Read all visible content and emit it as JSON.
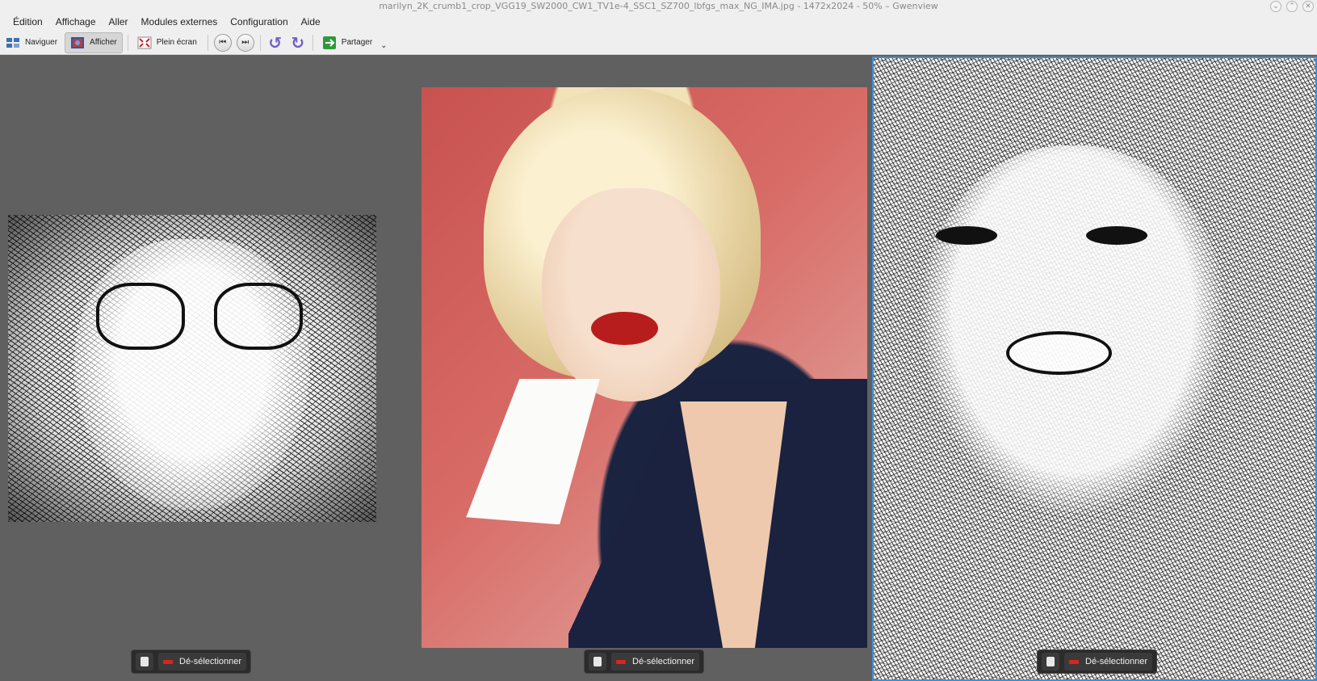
{
  "window": {
    "title": "marilyn_2K_crumb1_crop_VGG19_SW2000_CW1_TV1e-4_SSC1_SZ700_lbfgs_max_NG_IMA.jpg - 1472x2024 - 50% – Gwenview"
  },
  "menubar": {
    "items": [
      "Édition",
      "Affichage",
      "Aller",
      "Modules externes",
      "Configuration",
      "Aide"
    ]
  },
  "toolbar": {
    "browse_label": "Naviguer",
    "view_label": "Afficher",
    "fullscreen_label": "Plein écran",
    "share_label": "Partager"
  },
  "viewer": {
    "deselect_label": "Dé-sélectionner"
  },
  "colors": {
    "background": "#606060",
    "selection": "#3d8fd6",
    "deselect_icon": "#dd2222"
  }
}
